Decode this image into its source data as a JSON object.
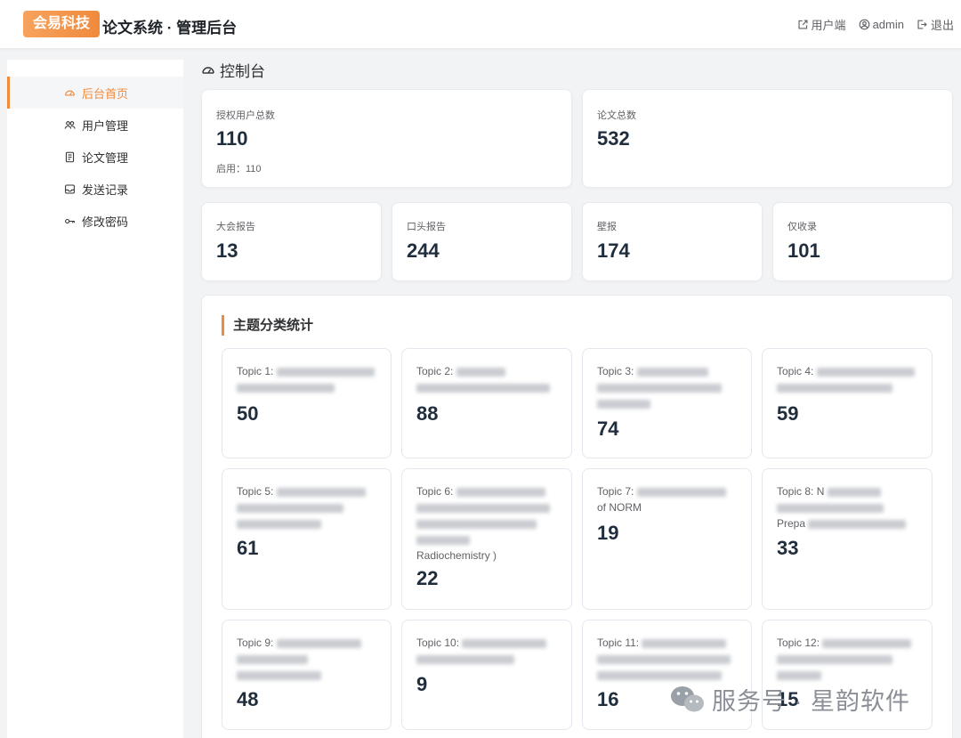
{
  "header": {
    "logo_text": "会易科技",
    "title": "论文系统 · 管理后台",
    "actions": [
      {
        "label": "用户端",
        "icon": "external-link-icon"
      },
      {
        "label": "admin",
        "icon": "user-circle-icon"
      },
      {
        "label": "退出",
        "icon": "logout-icon"
      }
    ]
  },
  "sidebar": {
    "items": [
      {
        "label": "后台首页",
        "icon": "dashboard-icon",
        "active": true
      },
      {
        "label": "用户管理",
        "icon": "users-icon",
        "active": false
      },
      {
        "label": "论文管理",
        "icon": "document-icon",
        "active": false
      },
      {
        "label": "发送记录",
        "icon": "inbox-icon",
        "active": false
      },
      {
        "label": "修改密码",
        "icon": "key-icon",
        "active": false
      }
    ]
  },
  "page": {
    "title": "控制台"
  },
  "stats": {
    "users_label": "授权用户总数",
    "users_value": "110",
    "users_enabled": "启用：110",
    "papers_label": "论文总数",
    "papers_value": "532",
    "plenary_label": "大会报告",
    "plenary_value": "13",
    "oral_label": "口头报告",
    "oral_value": "244",
    "poster_label": "壁报",
    "poster_value": "174",
    "accept_label": "仅收录",
    "accept_value": "101"
  },
  "topics": {
    "section_title": "主题分类统计",
    "items": [
      {
        "prefix": "Topic 1:",
        "tail": "",
        "value": "50"
      },
      {
        "prefix": "Topic 2:",
        "tail": "",
        "value": "88"
      },
      {
        "prefix": "Topic 3:",
        "tail": "",
        "value": "74"
      },
      {
        "prefix": "Topic 4:",
        "tail": "",
        "value": "59"
      },
      {
        "prefix": "Topic 5:",
        "tail": "",
        "value": "61"
      },
      {
        "prefix": "Topic 6:",
        "tail": "Radiochemistry )",
        "value": "22"
      },
      {
        "prefix": "Topic 7:",
        "tail": "of NORM",
        "value": "19"
      },
      {
        "prefix": "Topic 8: N",
        "tail": "Prepa",
        "value": "33"
      },
      {
        "prefix": "Topic 9:",
        "tail": "",
        "value": "48"
      },
      {
        "prefix": "Topic 10:",
        "tail": "",
        "value": "9"
      },
      {
        "prefix": "Topic 11:",
        "tail": "",
        "value": "16"
      },
      {
        "prefix": "Topic 12:",
        "tail": "",
        "value": "15"
      }
    ]
  },
  "watermark": {
    "text": "服务号 · 星韵软件",
    "icon": "wechat-icon"
  }
}
